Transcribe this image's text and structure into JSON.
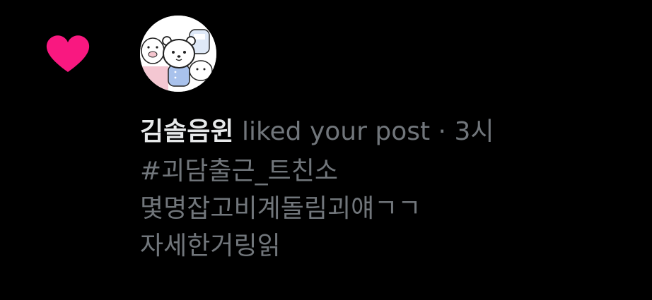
{
  "notification": {
    "type_icon": "heart-icon",
    "accent_color": "#f91880",
    "avatar_icon": "bear-character-avatar",
    "username": "김솔음윈",
    "action": "liked your post",
    "separator": "·",
    "time": "3시",
    "post_lines": [
      "#괴담출근_트친소",
      "몇명잡고비계돌림괴얘ㄱㄱ",
      "자세한거링읽"
    ]
  }
}
